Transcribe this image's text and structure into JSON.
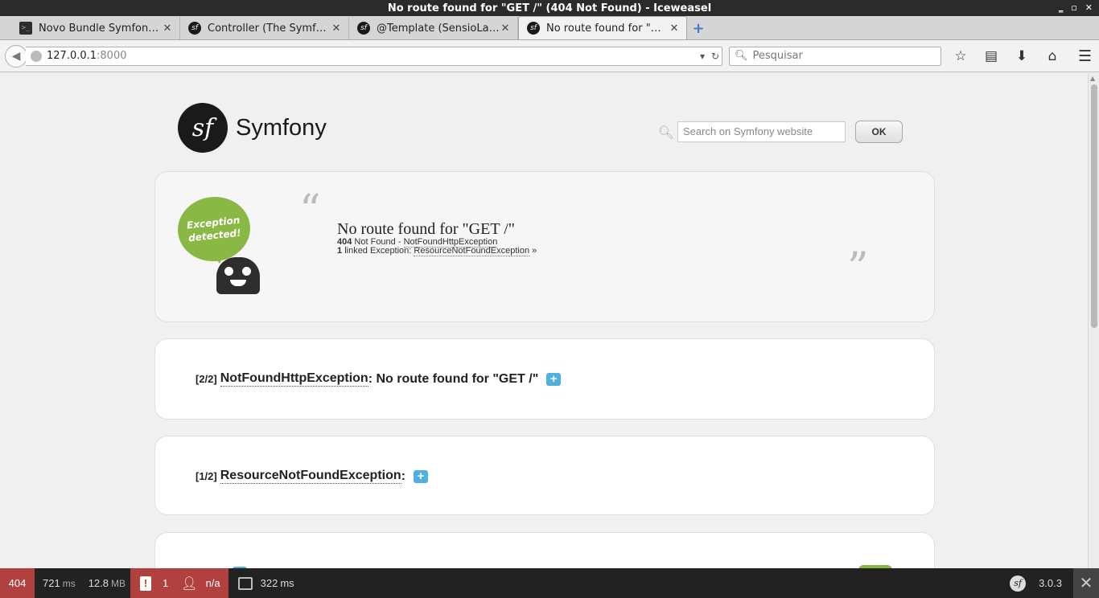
{
  "window": {
    "title": "No route found for \"GET /\" (404 Not Found) - Iceweasel",
    "controls": [
      "‗",
      "▫",
      "✕"
    ]
  },
  "tabs": [
    {
      "label": "Novo Bundle Symfony ...",
      "favicon": "terminal-icon"
    },
    {
      "label": "Controller (The Symfon...",
      "favicon": "symfony-icon"
    },
    {
      "label": "@Template (SensioLab...",
      "favicon": "symfony-icon"
    },
    {
      "label": "No route found for \"GE...",
      "favicon": "symfony-icon"
    }
  ],
  "navbar": {
    "url_host": "127.0.0.1",
    "url_port": ":8000",
    "search_placeholder": "Pesquisar"
  },
  "page": {
    "brand": "Symfony",
    "logo_glyph": "sf",
    "search_placeholder": "Search on Symfony website",
    "ok_label": "OK",
    "bubble_text": "Exception detected!",
    "exception": {
      "title": "No route found for \"GET /\"",
      "status_code": "404",
      "status_text": "Not Found - ",
      "class": "NotFoundHttpException",
      "linked_count": "1",
      "linked_text": "linked Exception: ",
      "linked_class": "ResourceNotFoundException",
      "linked_arrow": "»"
    },
    "blocks": [
      {
        "count": "[2/2]",
        "class": "NotFoundHttpException",
        "message": ": No route found for \"GET /\""
      },
      {
        "count": "[1/2]",
        "class": "ResourceNotFoundException",
        "message": ":"
      }
    ]
  },
  "toolbar": {
    "status": "404",
    "time": "721",
    "time_unit": "ms",
    "memory": "12.8",
    "memory_unit": "MB",
    "errors": "1",
    "user": "n/a",
    "render_time": "322",
    "render_unit": "ms",
    "version": "3.0.3"
  },
  "colors": {
    "error_red": "#b0413e",
    "symfony_green": "#8ab844",
    "plus_blue": "#4fb0e0"
  }
}
